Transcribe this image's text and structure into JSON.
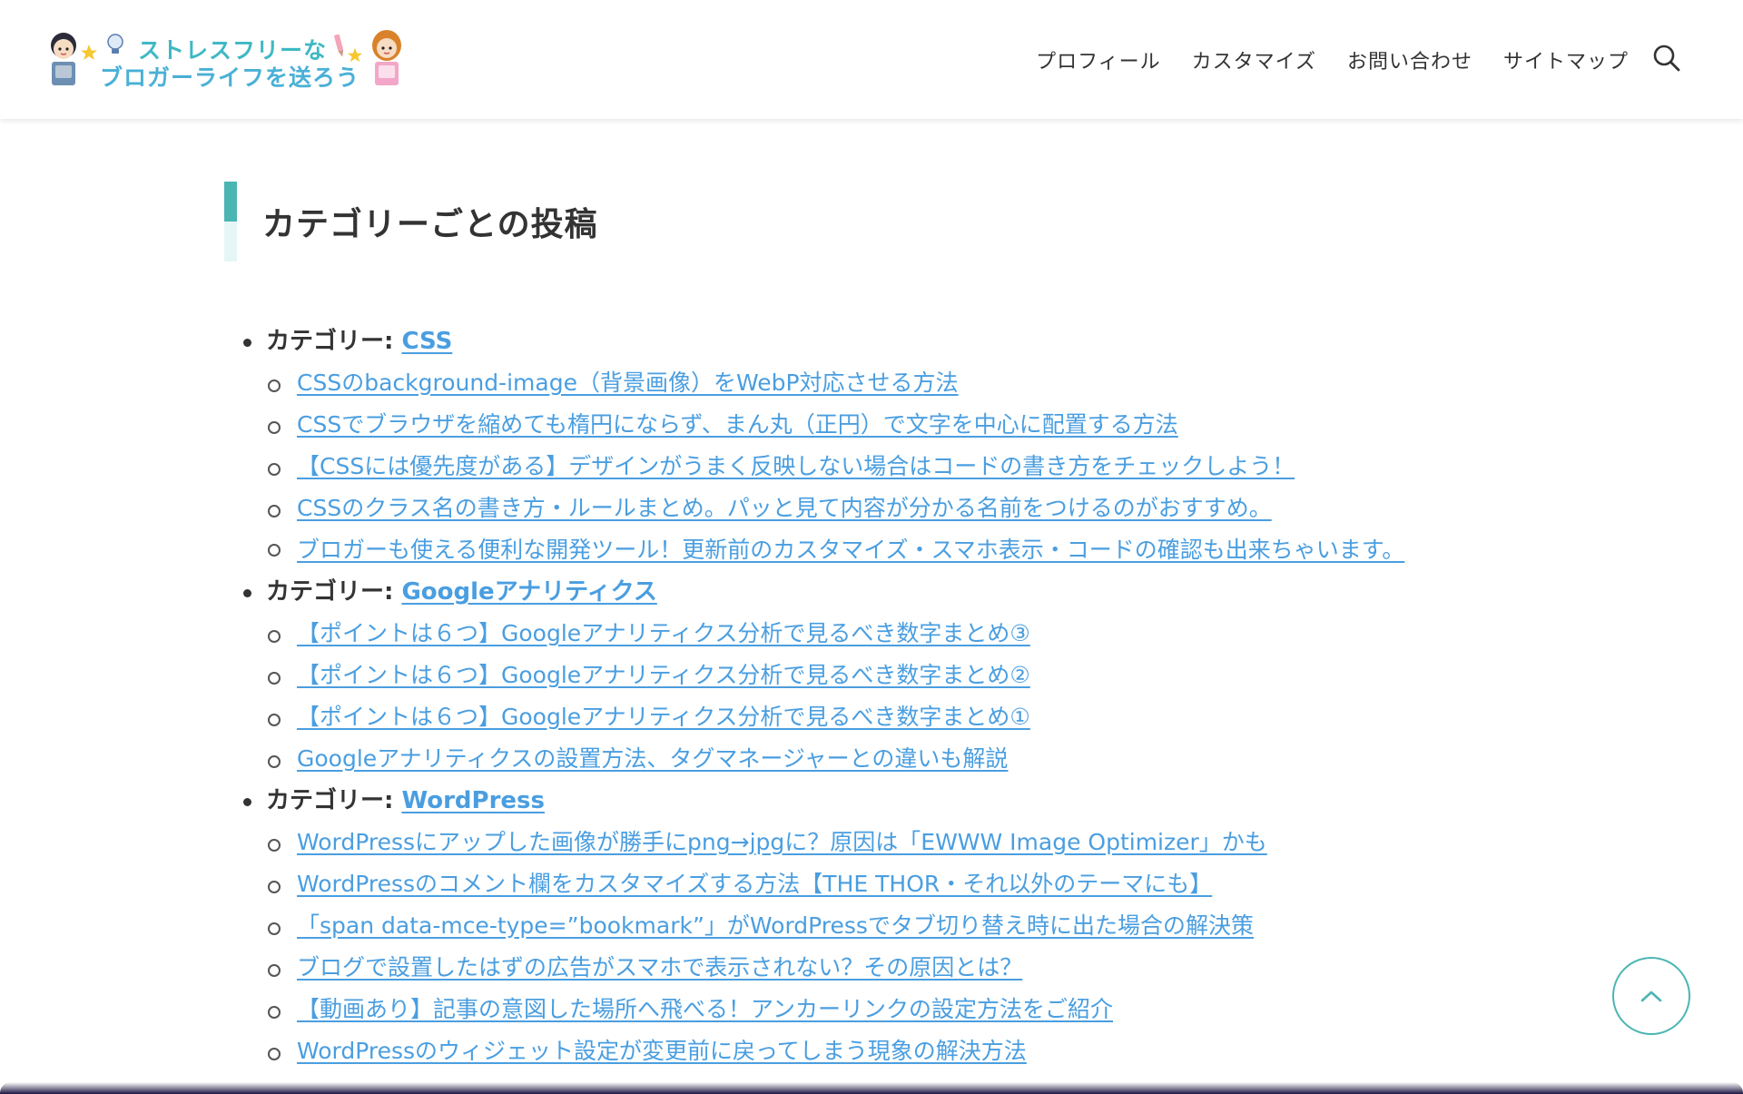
{
  "site": {
    "logo_line1": "ストレスフリーな",
    "logo_line2": "ブロガーライフを送ろう"
  },
  "nav": {
    "items": [
      "プロフィール",
      "カスタマイズ",
      "お問い合わせ",
      "サイトマップ"
    ],
    "search_icon": "search-icon"
  },
  "section": {
    "heading": "カテゴリーごとの投稿",
    "accent_color": "#4bb5b3"
  },
  "categories": [
    {
      "label": "カテゴリー:",
      "name": "CSS",
      "posts": [
        "CSSのbackground-image（背景画像）をWebP対応させる方法",
        "CSSでブラウザを縮めても楕円にならず、まん丸（正円）で文字を中心に配置する方法",
        "【CSSには優先度がある】デザインがうまく反映しない場合はコードの書き方をチェックしよう！",
        "CSSのクラス名の書き方・ルールまとめ。パッと見て内容が分かる名前をつけるのがおすすめ。",
        "ブロガーも使える便利な開発ツール！更新前のカスタマイズ・スマホ表示・コードの確認も出来ちゃいます。"
      ]
    },
    {
      "label": "カテゴリー:",
      "name": "Googleアナリティクス",
      "posts": [
        "【ポイントは６つ】Googleアナリティクス分析で見るべき数字まとめ③",
        "【ポイントは６つ】Googleアナリティクス分析で見るべき数字まとめ②",
        "【ポイントは６つ】Googleアナリティクス分析で見るべき数字まとめ①",
        "Googleアナリティクスの設置方法、タグマネージャーとの違いも解説"
      ]
    },
    {
      "label": "カテゴリー:",
      "name": "WordPress",
      "posts": [
        "WordPressにアップした画像が勝手にpng→jpgに？原因は「EWWW Image Optimizer」かも",
        "WordPressのコメント欄をカスタマイズする方法【THE THOR・それ以外のテーマにも】",
        "「span data-mce-type=”bookmark”」がWordPressでタブ切り替え時に出た場合の解決策",
        "ブログで設置したはずの広告がスマホで表示されない？その原因とは？",
        "【動画あり】記事の意図した場所へ飛べる！アンカーリンクの設定方法をご紹介",
        "WordPressのウィジェット設定が変更前に戻ってしまう現象の解決方法"
      ]
    }
  ],
  "colors": {
    "link": "#4a9ee0",
    "text": "#333333",
    "accent": "#4bb5b3"
  },
  "back_to_top_icon": "chevron-up-icon"
}
